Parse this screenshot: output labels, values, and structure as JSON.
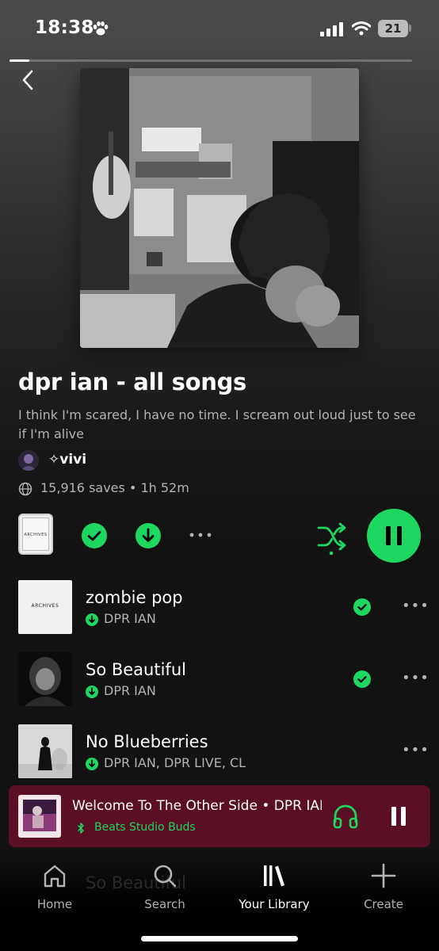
{
  "status_bar": {
    "time": "18:38",
    "battery": "21"
  },
  "playlist": {
    "title": "dpr ian - all songs",
    "description": "I think I'm scared, I have no time. I scream out loud just to see if I'm alive",
    "owner": "✧vivi",
    "meta": "15,916 saves • 1h 52m",
    "mini_cover_text": "ARCHIVES"
  },
  "tracks": [
    {
      "title": "zombie pop",
      "artist": "DPR IAN",
      "thumb_text": "ARCHIVES",
      "saved": true
    },
    {
      "title": "So Beautiful",
      "artist": "DPR IAN",
      "saved": true
    },
    {
      "title": "No Blueberries",
      "artist": "DPR IAN, DPR LIVE, CL",
      "saved": false
    }
  ],
  "now_playing": {
    "title": "Welcome To The Other Side • DPR IAN",
    "device": "Beats Studio Buds",
    "progress": 0.05
  },
  "ghost_track": "So Beautiful",
  "nav": {
    "home": "Home",
    "search": "Search",
    "library": "Your Library",
    "create": "Create"
  },
  "colors": {
    "accent": "#1ed760",
    "now_playing_bg": "#5a0f24"
  }
}
